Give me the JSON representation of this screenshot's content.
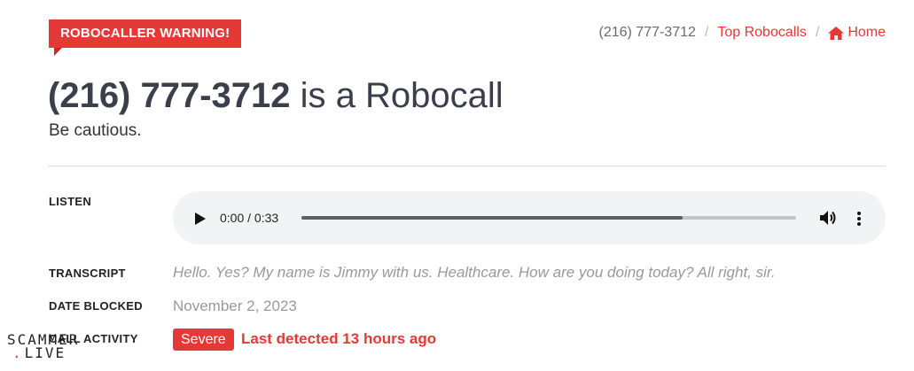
{
  "header": {
    "warning_tag": "ROBOCALLER WARNING!"
  },
  "breadcrumb": {
    "current": "(216) 777-3712",
    "separator": "/",
    "top_robocalls": "Top Robocalls",
    "home": "Home",
    "home_icon": "home-icon"
  },
  "title": {
    "number": "(216) 777-3712",
    "suffix": " is a Robocall",
    "subtitle": "Be cautious."
  },
  "listen": {
    "label": "LISTEN",
    "player": {
      "time": "0:00 / 0:33",
      "progress_fraction": 0.77,
      "icons": [
        "play-icon",
        "volume-icon",
        "more-vert-icon"
      ]
    }
  },
  "transcript": {
    "label": "TRANSCRIPT",
    "value": "Hello. Yes? My name is Jimmy with us. Healthcare. How are you doing today? All right, sir."
  },
  "date_blocked": {
    "label": "DATE BLOCKED",
    "value": "November 2, 2023"
  },
  "call_activity": {
    "label": "CALL ACTIVITY",
    "badge": "Severe",
    "detected": "Last detected 13 hours ago"
  },
  "watermark": {
    "line1": "SCAMMER",
    "line2": "LIVE"
  },
  "colors": {
    "accent": "#e53935",
    "title": "#3a3f4b",
    "muted": "#999999",
    "player_bg": "#f1f3f4"
  }
}
